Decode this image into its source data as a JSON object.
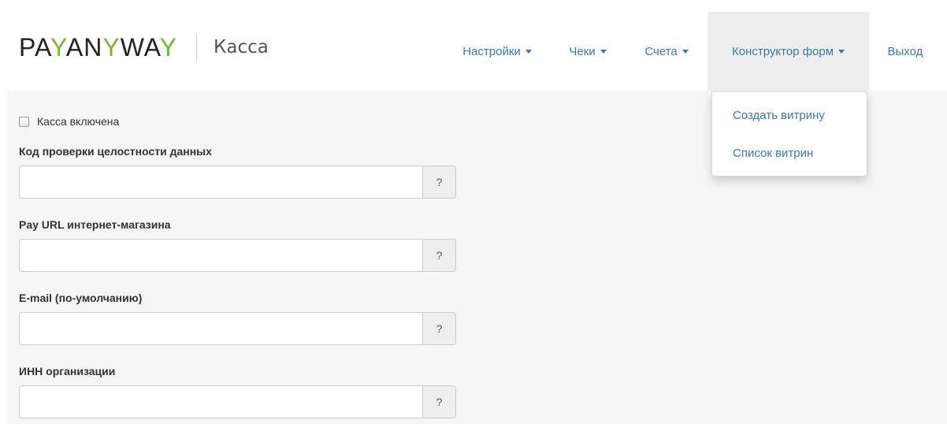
{
  "brand": {
    "logo_part1": "PA",
    "logo_y1": "Y",
    "logo_part2": "AN",
    "logo_y2": "Y",
    "logo_part3": "WA",
    "logo_y3": "Y",
    "subtitle": "Касса"
  },
  "nav": {
    "settings": "Настройки",
    "receipts": "Чеки",
    "invoices": "Счета",
    "form_builder": "Конструктор форм",
    "logout": "Выход"
  },
  "dropdown": {
    "create_showcase": "Создать витрину",
    "showcase_list": "Список витрин"
  },
  "form": {
    "kassa_enabled_label": "Касса включена",
    "kassa_enabled_checked": false,
    "fields": [
      {
        "label": "Код проверки целостности данных",
        "value": "",
        "help": "?"
      },
      {
        "label": "Pay URL интернет-магазина",
        "value": "",
        "help": "?"
      },
      {
        "label": "E-mail (по-умолчанию)",
        "value": "",
        "help": "?"
      },
      {
        "label": "ИНН организации",
        "value": "",
        "help": "?"
      }
    ]
  },
  "colors": {
    "link": "#337ab7",
    "logo_accent": "#76b82a",
    "content_bg": "#f6f6f6",
    "nav_open_bg": "#eeeeee"
  }
}
